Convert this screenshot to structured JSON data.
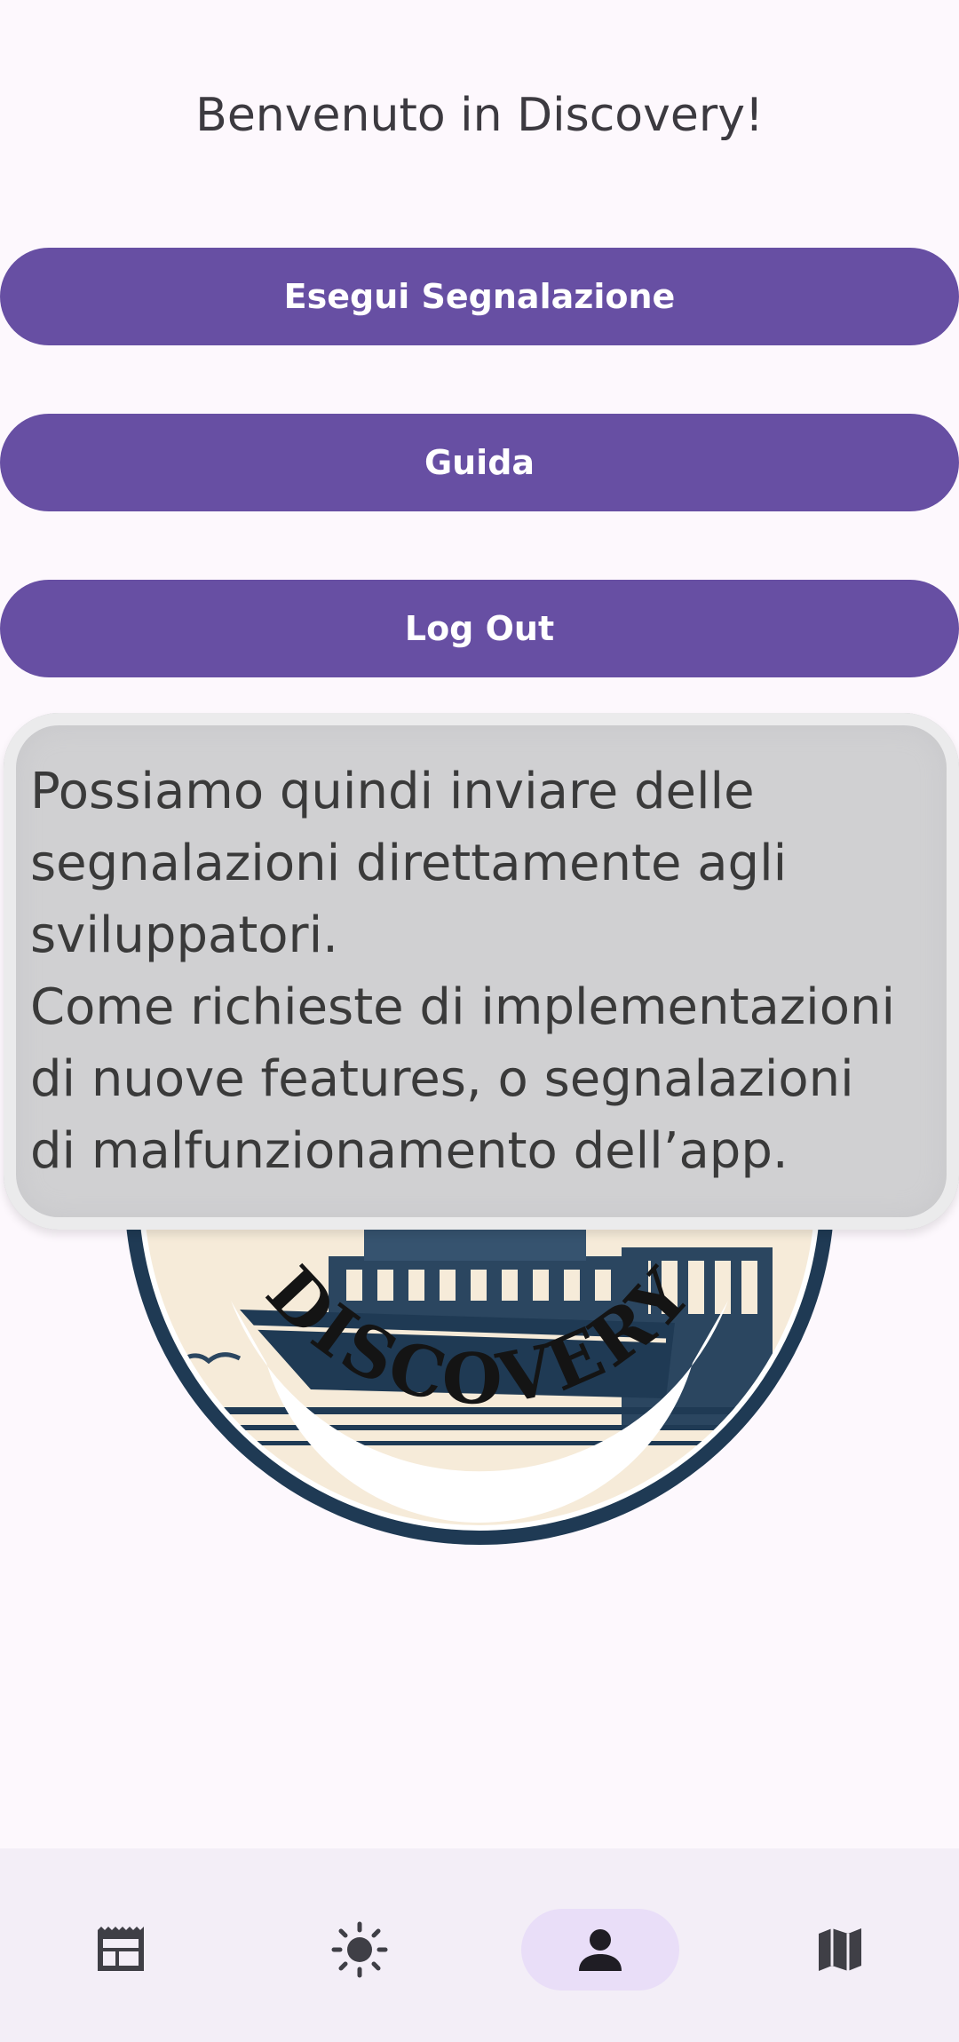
{
  "header": {
    "welcome_text": "Benvenuto in Discovery!"
  },
  "actions": {
    "report_label": "Esegui Segnalazione",
    "guide_label": "Guida",
    "logout_label": "Log Out"
  },
  "tooltip": {
    "text": "Possiamo quindi inviare delle\nsegnalazioni direttamente agli\nsviluppatori.\nCome richieste di implementazioni\ndi nuove features, o segnalazioni\ndi malfunzionamento dell’app."
  },
  "logo": {
    "text": "DISCOVERY"
  },
  "bottom_nav": {
    "items": [
      {
        "icon": "newspaper-icon",
        "active": false
      },
      {
        "icon": "sun-icon",
        "active": false
      },
      {
        "icon": "person-icon",
        "active": true
      },
      {
        "icon": "map-icon",
        "active": false
      }
    ]
  },
  "colors": {
    "primary": "#674fa3",
    "background": "#fdf8fd",
    "nav_background": "#f3eef7",
    "nav_active": "#e9def8",
    "tooltip_background": "#d0d0d2",
    "logo_ring": "#1f3a54",
    "logo_cream": "#f6ebd9"
  }
}
